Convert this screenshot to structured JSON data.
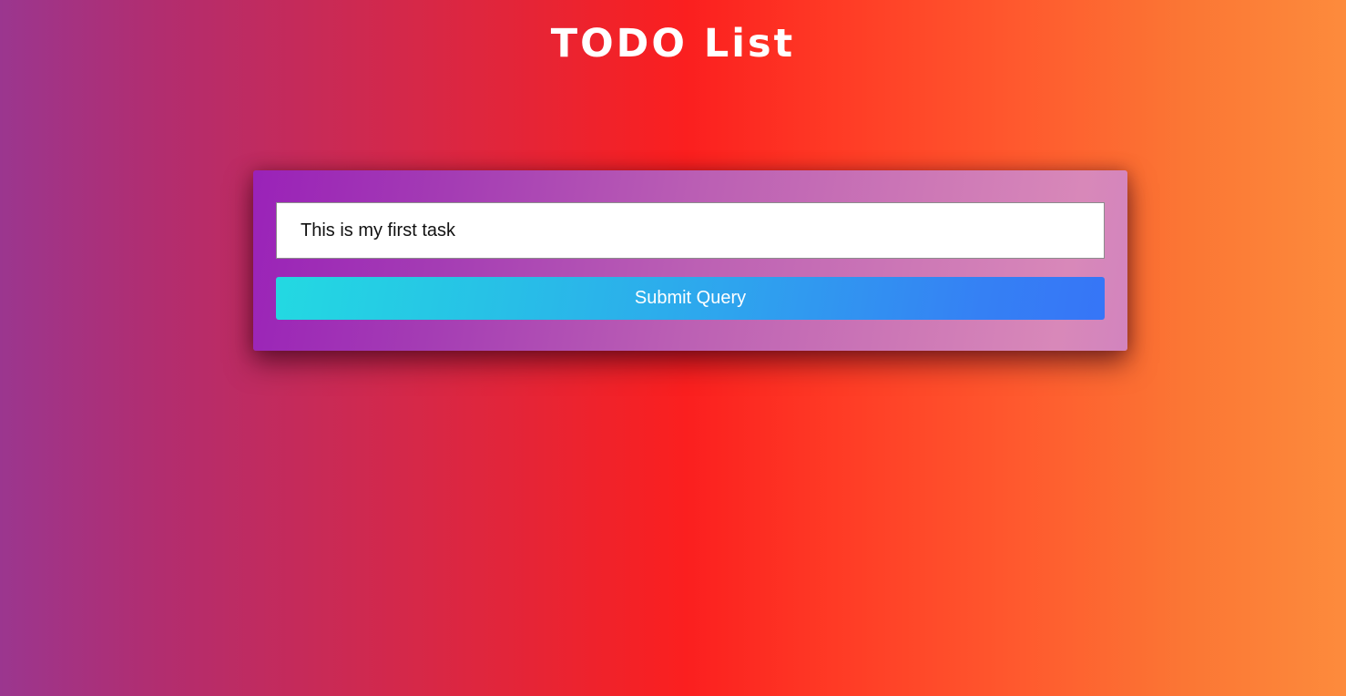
{
  "page": {
    "title": "TODO List"
  },
  "form": {
    "task_input_value": "This is my first task",
    "submit_label": "Submit Query"
  },
  "colors": {
    "background_left": "#9b368f",
    "background_center": "#fb1f1f",
    "background_right": "#fd8b3c",
    "card_left": "#9a22b8",
    "card_right": "#d888b9",
    "button_left": "#23d9e2",
    "button_right": "#3675f7",
    "title_text": "#ffffff"
  }
}
